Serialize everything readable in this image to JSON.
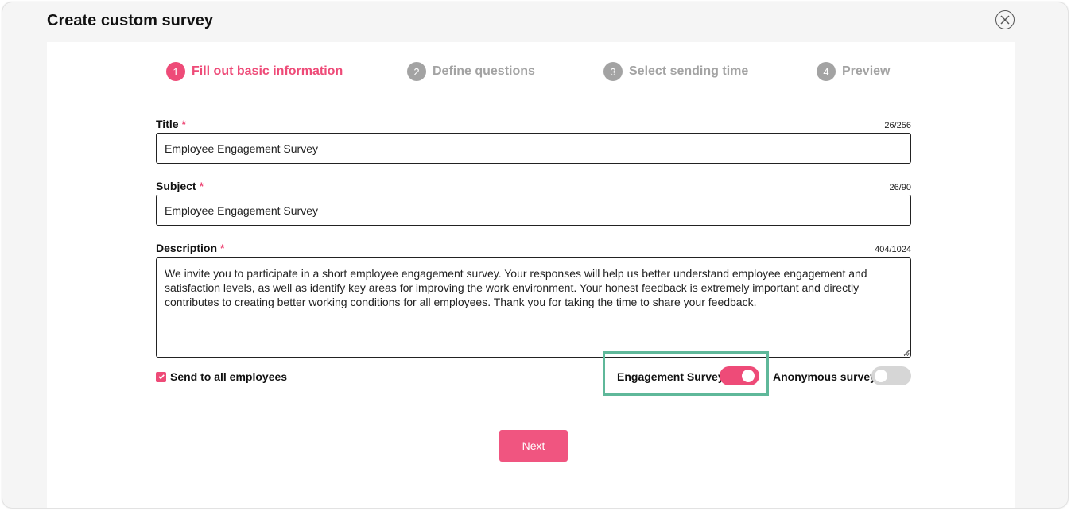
{
  "dialog": {
    "title": "Create custom survey",
    "close_icon": "close-icon"
  },
  "stepper": {
    "steps": [
      {
        "number": "1",
        "label": "Fill out basic information",
        "active": true
      },
      {
        "number": "2",
        "label": "Define questions",
        "active": false
      },
      {
        "number": "3",
        "label": "Select sending time",
        "active": false
      },
      {
        "number": "4",
        "label": "Preview",
        "active": false
      }
    ]
  },
  "form": {
    "title": {
      "label": "Title",
      "required_mark": "*",
      "value": "Employee Engagement Survey",
      "counter": "26/256"
    },
    "subject": {
      "label": "Subject",
      "required_mark": "*",
      "value": "Employee Engagement Survey",
      "counter": "26/90"
    },
    "description": {
      "label": "Description",
      "required_mark": "*",
      "value": "We invite you to participate in a short employee engagement survey. Your responses will help us better understand employee engagement and satisfaction levels, as well as identify key areas for improving the work environment. Your honest feedback is extremely important and directly contributes to creating better working conditions for all employees. Thank you for taking the time to share your feedback.",
      "counter": "404/1024"
    },
    "send_all": {
      "label": "Send to all employees",
      "checked": true
    },
    "engagement_toggle": {
      "label": "Engagement Survey",
      "on": true
    },
    "anonymous_toggle": {
      "label": "Anonymous survey",
      "on": false
    }
  },
  "actions": {
    "next_label": "Next"
  },
  "colors": {
    "accent": "#ee4b78",
    "inactive": "#a3a3a3",
    "highlight": "#5fb89a"
  }
}
